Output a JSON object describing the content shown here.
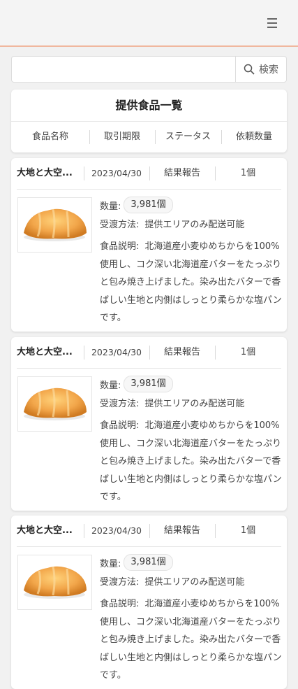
{
  "menu": {
    "icon": "hamburger-menu-icon"
  },
  "search": {
    "value": "",
    "placeholder": "",
    "button_label": "検索",
    "icon": "search-icon"
  },
  "list_header": {
    "title": "提供食品一覧",
    "columns": [
      "食品名称",
      "取引期限",
      "ステータス",
      "依頼数量"
    ]
  },
  "items": [
    {
      "name": "大地と大空...",
      "deadline": "2023/04/30",
      "status": "結果報告",
      "request_qty": "1個",
      "image": "croissant-bread-image",
      "quantity_label": "数量:",
      "quantity": "3,981個",
      "delivery_label": "受渡方法:",
      "delivery": "提供エリアのみ配送可能",
      "description_label": "食品説明:",
      "description": "北海道産小麦ゆめちからを100%使用し、コク深い北海道産バターをたっぷりと包み焼き上げました。染み出たバターで香ばしい生地と内側はしっとり柔らかな塩パンです。"
    },
    {
      "name": "大地と大空...",
      "deadline": "2023/04/30",
      "status": "結果報告",
      "request_qty": "1個",
      "image": "croissant-bread-image",
      "quantity_label": "数量:",
      "quantity": "3,981個",
      "delivery_label": "受渡方法:",
      "delivery": "提供エリアのみ配送可能",
      "description_label": "食品説明:",
      "description": "北海道産小麦ゆめちからを100%使用し、コク深い北海道産バターをたっぷりと包み焼き上げました。染み出たバターで香ばしい生地と内側はしっとり柔らかな塩パンです。"
    },
    {
      "name": "大地と大空...",
      "deadline": "2023/04/30",
      "status": "結果報告",
      "request_qty": "1個",
      "image": "croissant-bread-image",
      "quantity_label": "数量:",
      "quantity": "3,981個",
      "delivery_label": "受渡方法:",
      "delivery": "提供エリアのみ配送可能",
      "description_label": "食品説明:",
      "description": "北海道産小麦ゆめちからを100%使用し、コク深い北海道産バターをたっぷりと包み焼き上げました。染み出たバターで香ばしい生地と内側はしっとり柔らかな塩パンです。"
    }
  ],
  "colors": {
    "accent_line": "#f0b79e",
    "bread": "#f2a64a",
    "background": "#f1f1f1"
  }
}
